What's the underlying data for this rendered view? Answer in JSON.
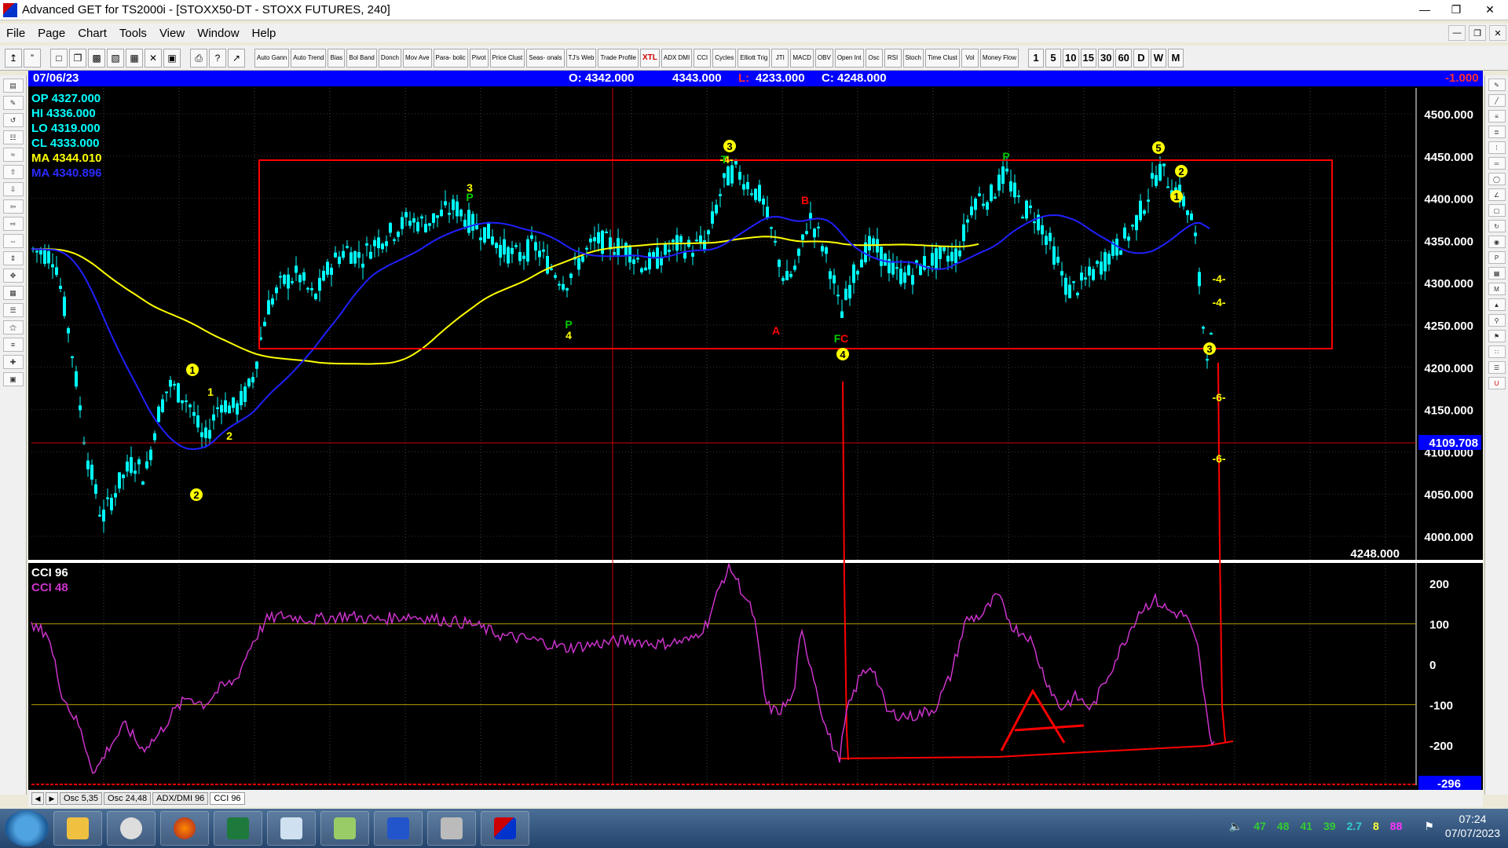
{
  "window": {
    "title": "Advanced GET for TS2000i - [STOXX50-DT - STOXX FUTURES, 240]",
    "min": "—",
    "max": "❐",
    "close": "✕"
  },
  "menu": [
    "File",
    "Page",
    "Chart",
    "Tools",
    "View",
    "Window",
    "Help"
  ],
  "toolbar": {
    "buttons": [
      "Auto Gann",
      "Auto Trend",
      "Bias",
      "Bol Band",
      "Donch",
      "Mov Ave",
      "Para- bolic",
      "Pivot",
      "Price Clust",
      "Seas- onals",
      "TJ's Web",
      "Trade Profile",
      "XTL",
      "ADX DMI",
      "CCI",
      "Cycles",
      "Elliott Trig",
      "JTI",
      "MACD",
      "OBV",
      "Open Int",
      "Osc",
      "RSI",
      "Stoch",
      "Time Clust",
      "Vol",
      "Money Flow"
    ],
    "timeframes": [
      "1",
      "5",
      "10",
      "15",
      "30",
      "60",
      "D",
      "W",
      "M"
    ]
  },
  "infobar": {
    "date": "07/06/23",
    "open": "O: 4342.000",
    "high": "4343.000",
    "low_label": "L:",
    "low_value": "4233.000",
    "close": "C: 4248.000",
    "change": "-1.000"
  },
  "ohlc_panel": {
    "op": "OP  4327.000",
    "hi": "HI   4336.000",
    "lo": "LO   4319.000",
    "cl": "CL   4333.000",
    "ma1": "MA  4344.010",
    "ma2": "MA  4340.896"
  },
  "price_axis": {
    "ticks": [
      "4500.000",
      "4450.000",
      "4400.000",
      "4350.000",
      "4300.000",
      "4250.000",
      "4200.000",
      "4150.000",
      "4100.000",
      "4050.000",
      "4000.000"
    ],
    "crosshair_value": "4109.708",
    "last_value": "4248.000"
  },
  "cci_panel": {
    "label1": "CCI 96",
    "label2": "CCI  48",
    "ticks": [
      "200",
      "100",
      "0",
      "-100",
      "-200"
    ],
    "value_box": "-296"
  },
  "wave_labels": {
    "circled": [
      "1",
      "2",
      "3",
      "4",
      "5",
      "2",
      "1",
      "3"
    ],
    "plain": [
      "1",
      "2",
      "3",
      "4",
      "P",
      "P",
      "P",
      "P",
      "B",
      "A",
      "F",
      "C",
      "T",
      "-4-",
      "-4-",
      "-6-",
      "-6-"
    ]
  },
  "colors": {
    "bg": "#000000",
    "candle": "#00ffff",
    "ma_yellow": "#ffff00",
    "ma_blue": "#2020ff",
    "box": "#ff0000",
    "cci": "#cc33cc",
    "label_yellow": "#ffff00",
    "infobar": "#0000ff"
  },
  "tabs": [
    "Osc 5,35",
    "Osc 24,48",
    "ADX/DMI 96",
    "CCI 96"
  ],
  "taskbar": {
    "tray_numbers": [
      "47",
      "48",
      "41",
      "39",
      "2.7",
      "8",
      "88"
    ],
    "time": "07:24",
    "date": "07/07/2023"
  }
}
